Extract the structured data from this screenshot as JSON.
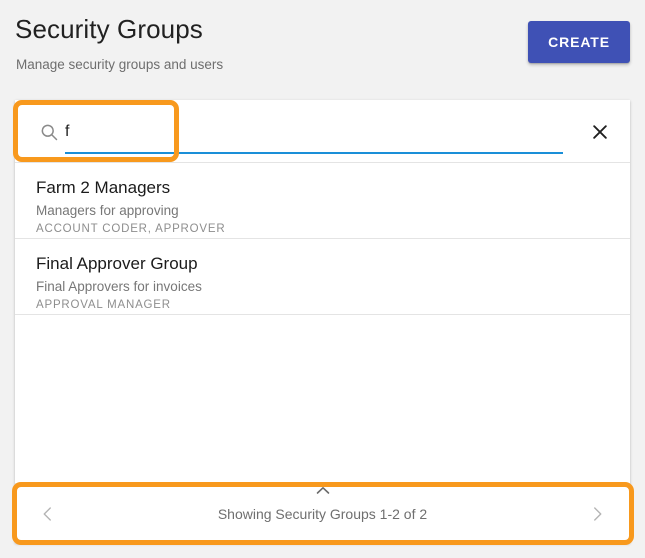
{
  "header": {
    "title": "Security Groups",
    "subtitle": "Manage security groups and users",
    "create_label": "CREATE"
  },
  "search": {
    "value": "f",
    "placeholder": "",
    "search_icon": "search-icon",
    "clear_icon": "close-icon"
  },
  "list": {
    "items": [
      {
        "name": "Farm 2 Managers",
        "description": "Managers for approving",
        "roles": "ACCOUNT CODER, APPROVER",
        "menu_icon": "more-vertical-icon"
      },
      {
        "name": "Final Approver Group",
        "description": "Final Approvers for invoices",
        "roles": "APPROVAL MANAGER",
        "menu_icon": "more-vertical-icon"
      }
    ]
  },
  "pagination": {
    "label": "Showing Security Groups 1-2 of 2",
    "prev_icon": "chevron-left-icon",
    "next_icon": "chevron-right-icon",
    "collapse_icon": "chevron-up-icon"
  },
  "colors": {
    "accent_button": "#3f51b5",
    "search_underline": "#1a8fd8",
    "annotation": "#f8991d",
    "page_background": "#f2f2f2",
    "card_background": "#ffffff"
  }
}
